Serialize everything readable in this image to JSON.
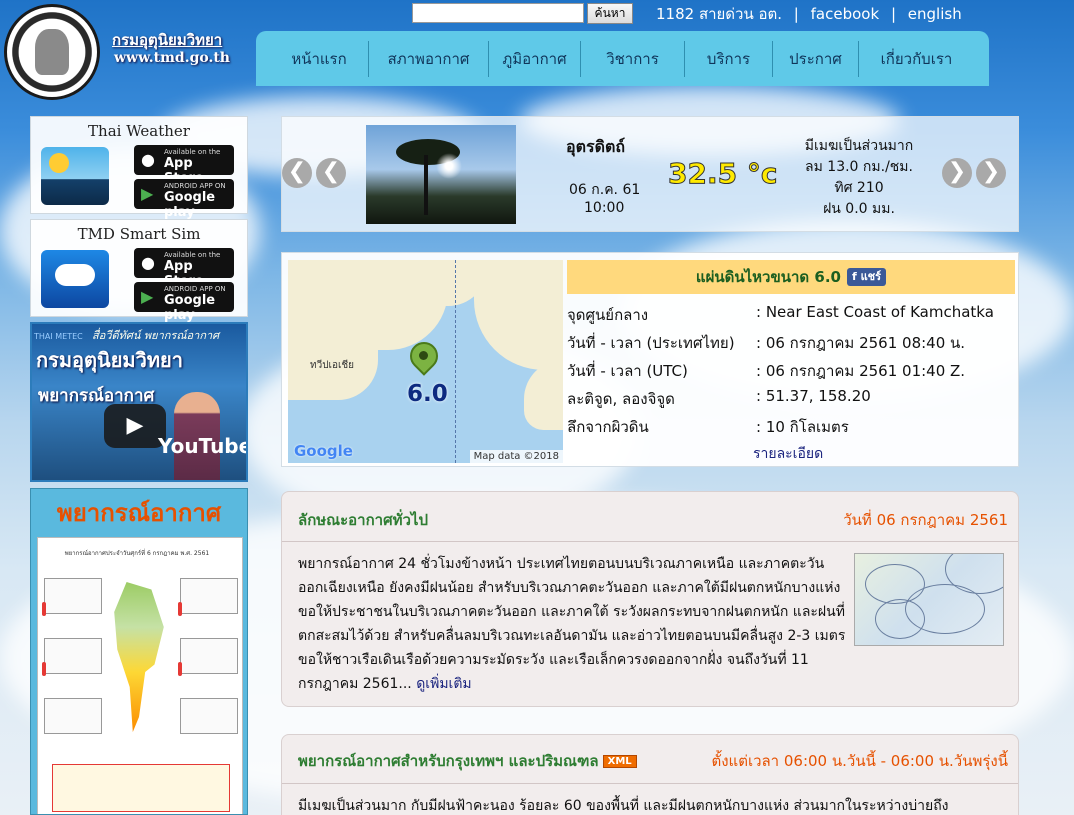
{
  "header": {
    "site_name": "กรมอุตุนิยมวิทยา",
    "site_url": "www.tmd.go.th",
    "search_button": "ค้นหา",
    "hotline": "1182 สายด่วน อต.",
    "facebook": "facebook",
    "english": "english",
    "sep": "|"
  },
  "nav": [
    "หน้าแรก",
    "สภาพอากาศ",
    "ภูมิอากาศ",
    "วิชาการ",
    "บริการ",
    "ประกาศ",
    "เกี่ยวกับเรา"
  ],
  "apps": {
    "thai_weather_title": "Thai Weather",
    "smart_sim_title": "TMD Smart Sim",
    "appstore_small": "Available on the",
    "appstore_big": "App Store",
    "gplay_small": "ANDROID APP ON",
    "gplay_big": "Google play"
  },
  "video": {
    "title": "กรมอุตุนิยมวิทยา",
    "kicker": "สื่อวีดีทัศน์ พยากรณ์อากาศ",
    "thai_metec": "THAI METEC",
    "sub": "พยากรณ์อากาศ",
    "youtube": "YouTube"
  },
  "forecast_image": {
    "title": "พยากรณ์อากาศ",
    "paper_head": "พยากรณ์อากาศประจำวันศุกร์ที่ 6 กรกฎาคม พ.ศ. 2561"
  },
  "weather": {
    "province": "อุตรดิตถ์",
    "date": "06 ก.ค. 61",
    "time": "10:00",
    "temperature": "32.5 °c",
    "condition": "มีเมฆเป็นส่วนมาก",
    "wind": "ลม 13.0 กม./ชม.",
    "direction": "ทิศ 210",
    "rain": "ฝน 0.0 มม.",
    "prev": "❮",
    "next": "❯"
  },
  "earthquake": {
    "header": "แผ่นดินไหวขนาด 6.0",
    "share": "แชร์",
    "map_label_land": "ทวีปเอเชีย",
    "map_magnitude": "6.0",
    "google": "Google",
    "map_data": "Map data ©2018",
    "rows": [
      {
        "label": "จุดศูนย์กลาง",
        "value": ": Near East Coast of Kamchatka"
      },
      {
        "label": "วันที่ - เวลา (ประเทศไทย)",
        "value": ": 06 กรกฎาคม 2561 08:40 น."
      },
      {
        "label": "วันที่ - เวลา (UTC)",
        "value": ": 06 กรกฎาคม 2561 01:40 Z."
      },
      {
        "label": "ละติจูด, ลองจิจูด",
        "value": ": 51.37, 158.20"
      },
      {
        "label": "ลึกจากผิวดิน",
        "value": ": 10 กิโลเมตร"
      }
    ],
    "more": "รายละเอียด"
  },
  "general": {
    "title": "ลักษณะอากาศทั่วไป",
    "date": "วันที่ 06 กรกฎาคม 2561",
    "body": "พยากรณ์อากาศ 24 ชั่วโมงข้างหน้า ประเทศไทยตอนบนบริเวณภาคเหนือ และภาคตะวันออกเฉียงเหนือ ยังคงมีฝนน้อย สำหรับบริเวณภาคตะวันออก และภาคใต้มีฝนตกหนักบางแห่ง ขอให้ประชาชนในบริเวณภาคตะวันออก และภาคใต้ ระวังผลกระทบจากฝนตกหนัก และฝนที่ตกสะสมไว้ด้วย สำหรับคลื่นลมบริเวณทะเลอันดามัน และอ่าวไทยตอนบนมีคลื่นสูง 2-3 เมตร ขอให้ชาวเรือเดินเรือด้วยความระมัดระวัง และเรือเล็กควรงดออกจากฝั่ง จนถึงวันที่ 11 กรกฎาคม 2561...",
    "more": "ดูเพิ่มเติม"
  },
  "bangkok": {
    "title": "พยากรณ์อากาศสำหรับกรุงเทพฯ และปริมณฑล",
    "xml": "XML",
    "time": "ตั้งแต่เวลา 06:00 น.วันนี้ - 06:00 น.วันพรุ่งนี้",
    "body": "มีเมฆเป็นส่วนมาก กับมีฝนฟ้าคะนอง ร้อยละ 60 ของพื้นที่ และมีฝนตกหนักบางแห่ง ส่วนมากในระหว่างบ่ายถึง"
  }
}
